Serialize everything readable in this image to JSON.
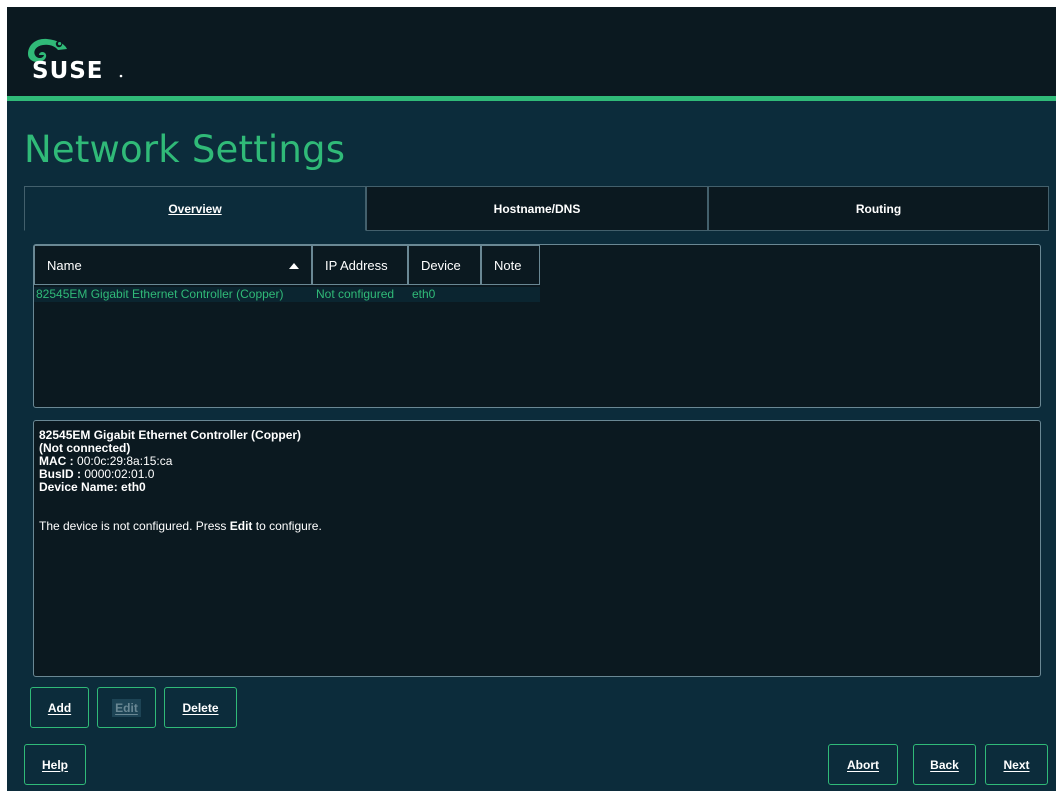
{
  "brand": {
    "logo_text": "SUSE",
    "accent": "#30ba78"
  },
  "page_title": "Network Settings",
  "tabs": [
    {
      "label": "Overview",
      "active": true
    },
    {
      "label": "Hostname/DNS",
      "active": false
    },
    {
      "label": "Routing",
      "active": false
    }
  ],
  "device_table": {
    "columns": [
      "Name",
      "IP Address",
      "Device",
      "Note"
    ],
    "sort_column": "Name",
    "rows": [
      {
        "name": "82545EM Gigabit Ethernet Controller (Copper)",
        "ip_address": "Not configured",
        "device": "eth0",
        "note": ""
      }
    ]
  },
  "details": {
    "title": "82545EM Gigabit Ethernet Controller (Copper)",
    "status": "(Not connected)",
    "mac_label": "MAC :",
    "mac_value": "00:0c:29:8a:15:ca",
    "busid_label": "BusID :",
    "busid_value": "0000:02:01.0",
    "device_name": "Device Name: eth0",
    "message_prefix": "The device is not configured. Press ",
    "message_action": "Edit",
    "message_suffix": " to configure."
  },
  "buttons": {
    "add": "Add",
    "edit": "Edit",
    "delete": "Delete",
    "help": "Help",
    "abort": "Abort",
    "back": "Back",
    "next": "Next"
  }
}
